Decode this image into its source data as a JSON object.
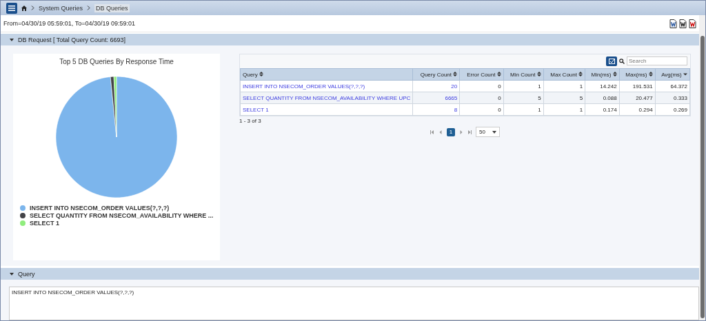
{
  "breadcrumb": {
    "items": [
      "System Queries",
      "DB Queries"
    ]
  },
  "time_range": "From=04/30/19 05:59:01, To=04/30/19 09:59:01",
  "db_section": {
    "title": "DB Request [ Total Query Count: 6693]",
    "expanded": true
  },
  "chart": {
    "title": "Top 5 DB Queries By Response Time",
    "legend": [
      {
        "label": "INSERT INTO NSECOM_ORDER VALUES(?,?,?)",
        "color": "#7cb5ec"
      },
      {
        "label": "SELECT QUANTITY FROM NSECOM_AVAILABILITY WHERE ...",
        "color": "#434348"
      },
      {
        "label": "SELECT 1",
        "color": "#90ed7d"
      }
    ]
  },
  "search": {
    "placeholder": "Search"
  },
  "table": {
    "columns": [
      {
        "label": "Query",
        "sorted_desc": false
      },
      {
        "label": "Query Count",
        "sorted_desc": false
      },
      {
        "label": "Error Count",
        "sorted_desc": false
      },
      {
        "label": "Min Count",
        "sorted_desc": false
      },
      {
        "label": "Max Count",
        "sorted_desc": false
      },
      {
        "label": "Min(ms)",
        "sorted_desc": false
      },
      {
        "label": "Max(ms)",
        "sorted_desc": false
      },
      {
        "label": "Avg(ms)",
        "sorted_desc": true
      }
    ],
    "rows": [
      [
        "INSERT INTO NSECOM_ORDER VALUES(?,?,?)",
        "20",
        "0",
        "1",
        "1",
        "14.242",
        "191.531",
        "64.372"
      ],
      [
        "SELECT QUANTITY FROM NSECOM_AVAILABILITY WHERE UPC",
        "6665",
        "0",
        "5",
        "5",
        "0.088",
        "20.477",
        "0.333"
      ],
      [
        "SELECT 1",
        "8",
        "0",
        "1",
        "1",
        "0.174",
        "0.294",
        "0.269"
      ]
    ],
    "summary": "1 - 3 of 3"
  },
  "pager": {
    "pages": [
      {
        "label": "1",
        "selected": true
      }
    ],
    "page_size": "50"
  },
  "query_section": {
    "title": "Query",
    "expanded": true,
    "text": "INSERT INTO NSECOM_ORDER VALUES(?,?,?)"
  }
}
